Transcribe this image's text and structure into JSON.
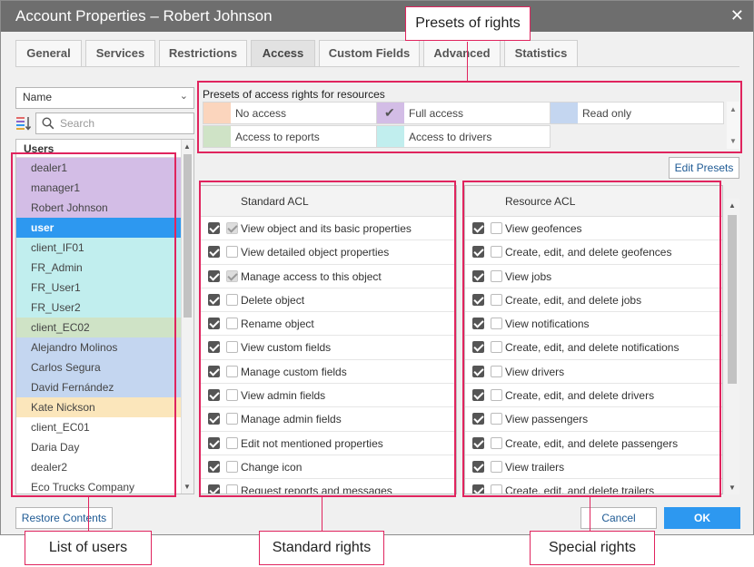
{
  "window": {
    "title": "Account Properties – Robert Johnson",
    "close_icon": "close-icon"
  },
  "tabs": [
    {
      "label": "General",
      "active": false
    },
    {
      "label": "Services",
      "active": false
    },
    {
      "label": "Restrictions",
      "active": false
    },
    {
      "label": "Access",
      "active": true
    },
    {
      "label": "Custom Fields",
      "active": false
    },
    {
      "label": "Advanced",
      "active": false
    },
    {
      "label": "Statistics",
      "active": false
    }
  ],
  "sort": {
    "selected": "Name"
  },
  "search": {
    "placeholder": "Search"
  },
  "users": {
    "header": "Users",
    "items": [
      {
        "name": "dealer1",
        "color": "#d3bde6"
      },
      {
        "name": "manager1",
        "color": "#d3bde6"
      },
      {
        "name": "Robert Johnson",
        "color": "#d3bde6"
      },
      {
        "name": "user",
        "color": "#2d98f0",
        "selected": true
      },
      {
        "name": "client_IF01",
        "color": "#c1eeee"
      },
      {
        "name": "FR_Admin",
        "color": "#c1eeee"
      },
      {
        "name": "FR_User1",
        "color": "#c1eeee"
      },
      {
        "name": "FR_User2",
        "color": "#c1eeee"
      },
      {
        "name": "client_EC02",
        "color": "#cfe3c6"
      },
      {
        "name": "Alejandro Molinos",
        "color": "#c4d6f0"
      },
      {
        "name": "Carlos Segura",
        "color": "#c4d6f0"
      },
      {
        "name": "David Fernández",
        "color": "#c4d6f0"
      },
      {
        "name": "Kate Nickson",
        "color": "#fbe6bb"
      },
      {
        "name": "client_EC01",
        "color": "#ffffff"
      },
      {
        "name": "Daria Day",
        "color": "#ffffff"
      },
      {
        "name": "dealer2",
        "color": "#ffffff"
      },
      {
        "name": "Eco Trucks Company",
        "color": "#ffffff"
      }
    ]
  },
  "presets": {
    "caption": "Presets of access rights for resources",
    "items": [
      {
        "label": "No access",
        "color": "#fbd5bd",
        "checked": false
      },
      {
        "label": "Full access",
        "color": "#d3bde6",
        "checked": true
      },
      {
        "label": "Read only",
        "color": "#c4d6f0",
        "checked": false
      },
      {
        "label": "Access to reports",
        "color": "#cfe3c6",
        "checked": false
      },
      {
        "label": "Access to drivers",
        "color": "#c1eeee",
        "checked": false
      }
    ]
  },
  "buttons": {
    "edit_presets": "Edit Presets",
    "restore": "Restore Contents",
    "cancel": "Cancel",
    "ok": "OK"
  },
  "standard_acl": {
    "header": "Standard ACL",
    "rows": [
      {
        "label": "View object and its basic properties",
        "inherited": "disabled"
      },
      {
        "label": "View detailed object properties",
        "inherited": "off"
      },
      {
        "label": "Manage access to this object",
        "inherited": "disabled"
      },
      {
        "label": "Delete object",
        "inherited": "off"
      },
      {
        "label": "Rename object",
        "inherited": "off"
      },
      {
        "label": "View custom fields",
        "inherited": "off"
      },
      {
        "label": "Manage custom fields",
        "inherited": "off"
      },
      {
        "label": "View admin fields",
        "inherited": "off"
      },
      {
        "label": "Manage admin fields",
        "inherited": "off"
      },
      {
        "label": "Edit not mentioned properties",
        "inherited": "off"
      },
      {
        "label": "Change icon",
        "inherited": "off"
      },
      {
        "label": "Request reports and messages",
        "inherited": "off"
      }
    ]
  },
  "resource_acl": {
    "header": "Resource ACL",
    "rows": [
      {
        "label": "View geofences",
        "inherited": "off"
      },
      {
        "label": "Create, edit, and delete geofences",
        "inherited": "off"
      },
      {
        "label": "View jobs",
        "inherited": "off"
      },
      {
        "label": "Create, edit, and delete jobs",
        "inherited": "off"
      },
      {
        "label": "View notifications",
        "inherited": "off"
      },
      {
        "label": "Create, edit, and delete notifications",
        "inherited": "off"
      },
      {
        "label": "View drivers",
        "inherited": "off"
      },
      {
        "label": "Create, edit, and delete drivers",
        "inherited": "off"
      },
      {
        "label": "View passengers",
        "inherited": "off"
      },
      {
        "label": "Create, edit, and delete passengers",
        "inherited": "off"
      },
      {
        "label": "View trailers",
        "inherited": "off"
      },
      {
        "label": "Create, edit, and delete trailers",
        "inherited": "off"
      }
    ]
  },
  "annotations": {
    "presets": "Presets of rights",
    "users": "List of users",
    "standard": "Standard rights",
    "special": "Special rights",
    "color": "#e0245e"
  }
}
